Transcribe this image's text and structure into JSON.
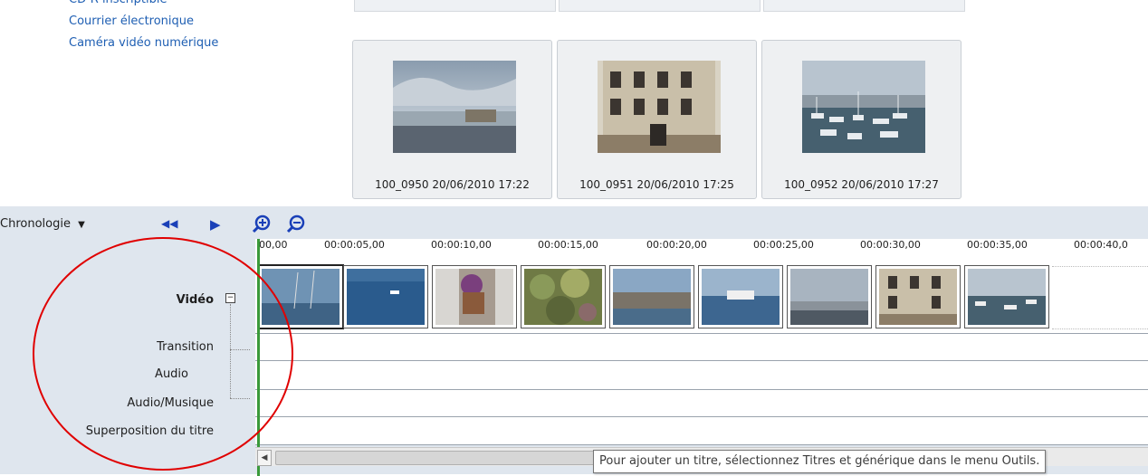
{
  "publish_links": [
    "CD-R inscriptible",
    "Courrier électronique",
    "Caméra vidéo numérique"
  ],
  "collection_tiles": [
    {
      "caption": "100_0950 20/06/2010 17:22",
      "thumbnail": "harbor-fortress-photo"
    },
    {
      "caption": "100_0951 20/06/2010 17:25",
      "thumbnail": "old-building-photo"
    },
    {
      "caption": "100_0952 20/06/2010 17:27",
      "thumbnail": "marina-boats-photo"
    }
  ],
  "timeline": {
    "view_label": "Chronologie",
    "ruler_ticks": [
      "00,00",
      "00:00:05,00",
      "00:00:10,00",
      "00:00:15,00",
      "00:00:20,00",
      "00:00:25,00",
      "00:00:30,00",
      "00:00:35,00",
      "00:00:40,0"
    ],
    "tracks": {
      "video": "Vidéo",
      "transition": "Transition",
      "audio": "Audio",
      "audio_music": "Audio/Musique",
      "title_overlay": "Superposition du titre"
    },
    "clips": [
      "sea-mast-clip",
      "sea-boat-clip",
      "flower-pot-clip",
      "cactus-clip",
      "fortress-clip",
      "yacht-clip",
      "harbor-clip",
      "building-clip",
      "marina-clip"
    ]
  },
  "tooltip": "Pour ajouter un titre, sélectionnez Titres et générique dans le menu Outils.",
  "colors": {
    "link": "#1f5fb3",
    "panel": "#dfe6ee",
    "playhead": "#3a9a3a",
    "annotation": "#e00000"
  }
}
